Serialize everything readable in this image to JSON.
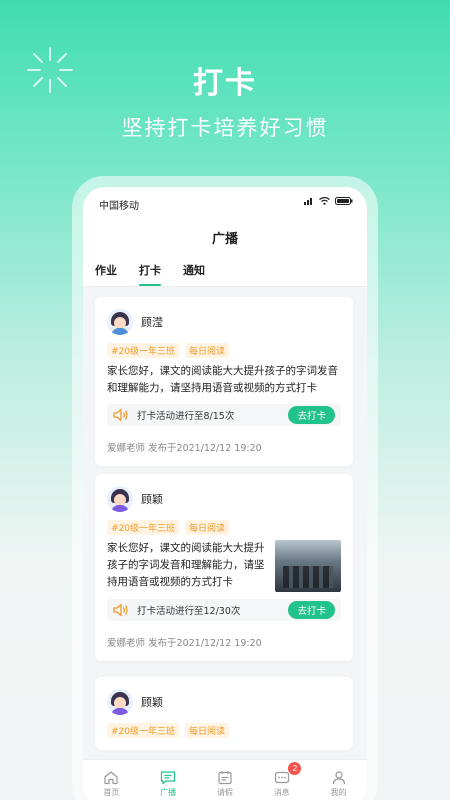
{
  "hero": {
    "title": "打卡",
    "subtitle": "坚持打卡培养好习惯"
  },
  "status_bar": {
    "carrier": "中国移动"
  },
  "nav": {
    "title": "广播"
  },
  "tabs": [
    {
      "label": "作业",
      "active": false
    },
    {
      "label": "打卡",
      "active": true
    },
    {
      "label": "通知",
      "active": false
    }
  ],
  "posts": [
    {
      "name": "顾滢",
      "tags": [
        "#20级一年三班",
        "每日阅读"
      ],
      "content": "家长您好，课文的阅读能大大提升孩子的字词发音和理解能力，请坚持用语音或视频的方式打卡",
      "activity": "打卡活动进行至8/15次",
      "button": "去打卡",
      "meta": "爱娜老师 发布于2021/12/12 19:20"
    },
    {
      "name": "顾颖",
      "tags": [
        "#20级一年三班",
        "每日阅读"
      ],
      "content": "家长您好，课文的阅读能大大提升孩子的字词发音和理解能力，请坚持用语音或视频的方式打卡",
      "activity": "打卡活动进行至12/30次",
      "button": "去打卡",
      "meta": "爱娜老师 发布于2021/12/12 19:20"
    },
    {
      "name": "顾颖",
      "tags": [
        "#20级一年三班",
        "每日阅读"
      ]
    }
  ],
  "bottom_nav": [
    {
      "label": "首页",
      "icon": "home-icon",
      "active": false
    },
    {
      "label": "广播",
      "icon": "broadcast-icon",
      "active": true
    },
    {
      "label": "请假",
      "icon": "leave-icon",
      "active": false
    },
    {
      "label": "消息",
      "icon": "message-icon",
      "active": false,
      "badge": "2"
    },
    {
      "label": "我的",
      "icon": "profile-icon",
      "active": false
    }
  ],
  "colors": {
    "accent": "#21c28c",
    "tag_text": "#f19a2a",
    "badge": "#f5544b"
  }
}
